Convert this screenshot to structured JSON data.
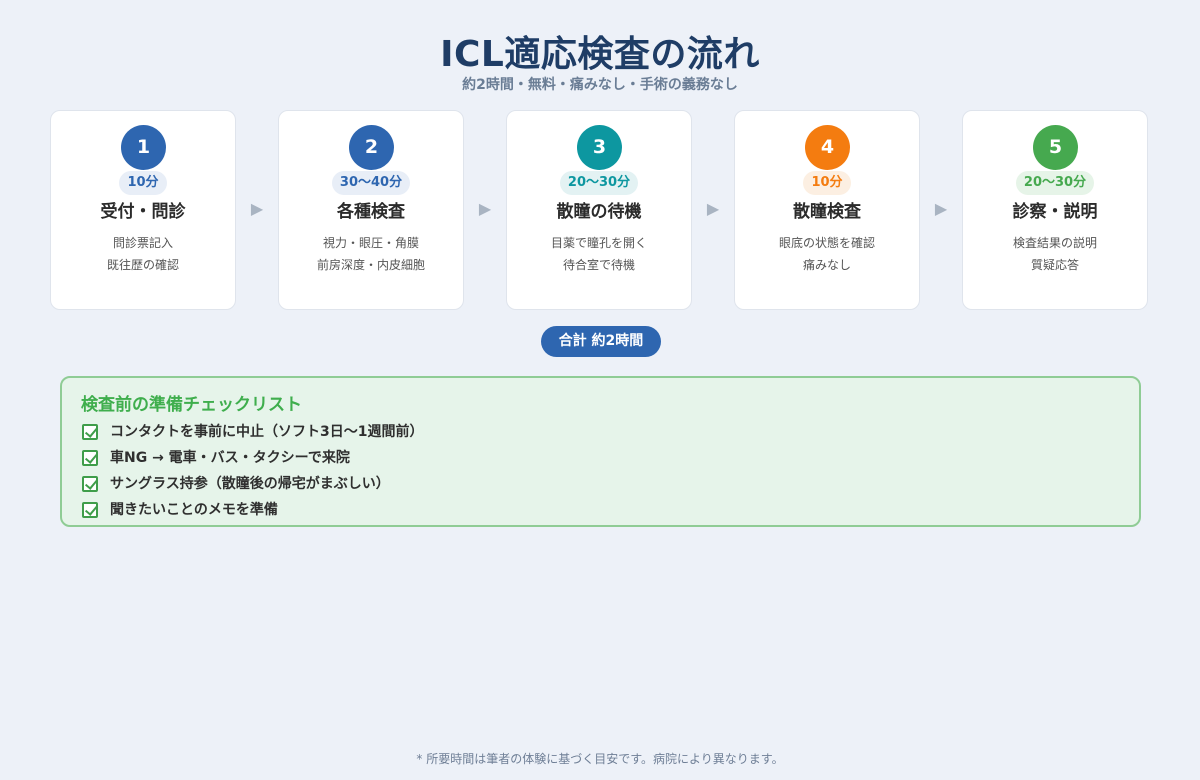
{
  "header": {
    "title": "ICL適応検査の流れ",
    "subtitle": "約2時間・無料・痛みなし・手術の義務なし"
  },
  "steps": [
    {
      "number": "1",
      "time": "10分",
      "title": "受付・問診",
      "desc1": "問診票記入",
      "desc2": "既往歴の確認",
      "color": "#2e66b0",
      "time_bg": "#e8eef7"
    },
    {
      "number": "2",
      "time": "30〜40分",
      "title": "各種検査",
      "desc1": "視力・眼圧・角膜",
      "desc2": "前房深度・内皮細胞",
      "color": "#2e66b0",
      "time_bg": "#e8eef7"
    },
    {
      "number": "3",
      "time": "20〜30分",
      "title": "散瞳の待機",
      "desc1": "目薬で瞳孔を開く",
      "desc2": "待合室で待機",
      "color": "#0d97a0",
      "time_bg": "#e3f2f3"
    },
    {
      "number": "4",
      "time": "10分",
      "title": "散瞳検査",
      "desc1": "眼底の状態を確認",
      "desc2": "痛みなし",
      "color": "#f47c10",
      "time_bg": "#fcefe2"
    },
    {
      "number": "5",
      "time": "20〜30分",
      "title": "診察・説明",
      "desc1": "検査結果の説明",
      "desc2": "質疑応答",
      "color": "#46a94f",
      "time_bg": "#e6f4e8"
    }
  ],
  "arrow_glyph": "▶",
  "total": "合計 約2時間",
  "checklist": {
    "title": "検査前の準備チェックリスト",
    "items": [
      "コンタクトを事前に中止（ソフト3日〜1週間前）",
      "車NG → 電車・バス・タクシーで来院",
      "サングラス持参（散瞳後の帰宅がまぶしい）",
      "聞きたいことのメモを準備"
    ]
  },
  "footnote": "* 所要時間は筆者の体験に基づく目安です。病院により異なります。"
}
